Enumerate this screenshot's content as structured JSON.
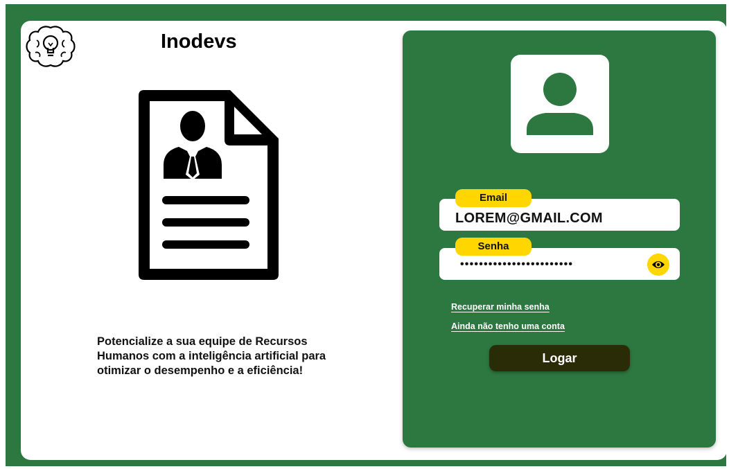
{
  "brand": {
    "name": "Inodevs",
    "logo_icon": "brain-lightbulb-icon"
  },
  "hero": {
    "illustration_icon": "resume-document-icon",
    "tagline": "Potencialize a sua equipe de Recursos Humanos com a inteligência artificial para otimizar o desempenho e a eficiência!"
  },
  "login": {
    "avatar_icon": "user-avatar-icon",
    "email": {
      "label": "Email",
      "value": "LOREM@GMAIL.COM"
    },
    "password": {
      "label": "Senha",
      "value": "••••••••••••••••••••••••",
      "toggle_icon": "eye-icon"
    },
    "links": {
      "recover": "Recuperar minha senha",
      "signup": "Ainda não tenho uma conta"
    },
    "submit_label": "Logar"
  },
  "colors": {
    "brand_green": "#2d7740",
    "accent_yellow": "#ffd600",
    "button_dark": "#2a2c08"
  }
}
